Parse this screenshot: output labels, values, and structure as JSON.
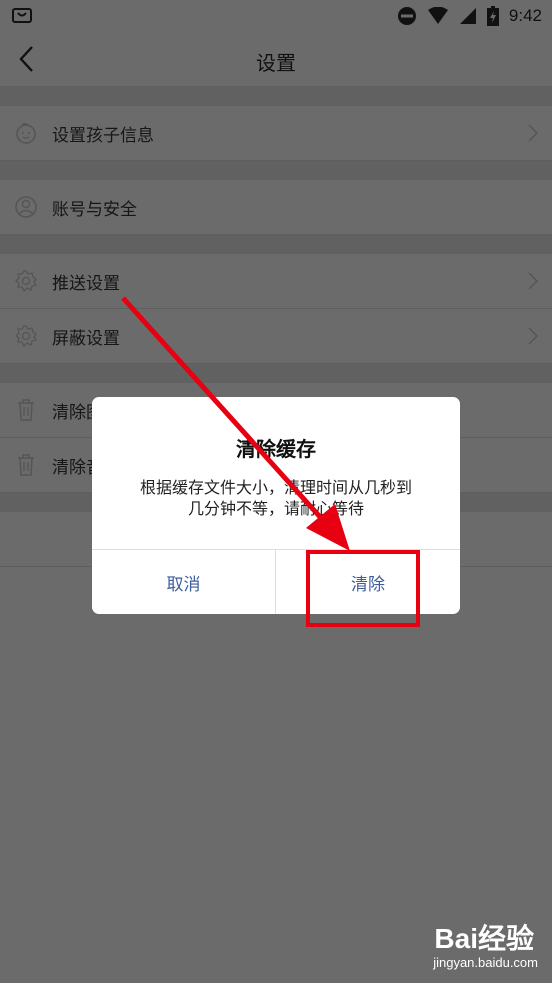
{
  "status_bar": {
    "time": "9:42",
    "icons": [
      "store-icon",
      "do-not-disturb-icon",
      "wifi-icon",
      "cellular-icon",
      "battery-charging-icon"
    ]
  },
  "header": {
    "title": "设置",
    "back_icon": "chevron-left-icon"
  },
  "settings": {
    "items": [
      {
        "label": "设置孩子信息",
        "icon": "child-face-icon"
      },
      {
        "label": "账号与安全",
        "icon": "person-icon"
      },
      {
        "label": "推送设置",
        "icon": "gear-icon"
      },
      {
        "label": "屏蔽设置",
        "icon": "gear-icon"
      },
      {
        "label": "清除图",
        "icon": "trash-icon"
      },
      {
        "label": "清除音",
        "icon": "trash-icon"
      }
    ]
  },
  "dialog": {
    "title": "清除缓存",
    "message_line1": "根据缓存文件大小，清理时间从几秒到",
    "message_line2": "几分钟不等，请耐心等待",
    "cancel_label": "取消",
    "confirm_label": "清除"
  },
  "annotation": {
    "color": "#e60012"
  },
  "watermark": {
    "logo_text": "Bai经验",
    "url": "jingyan.baidu.com"
  }
}
